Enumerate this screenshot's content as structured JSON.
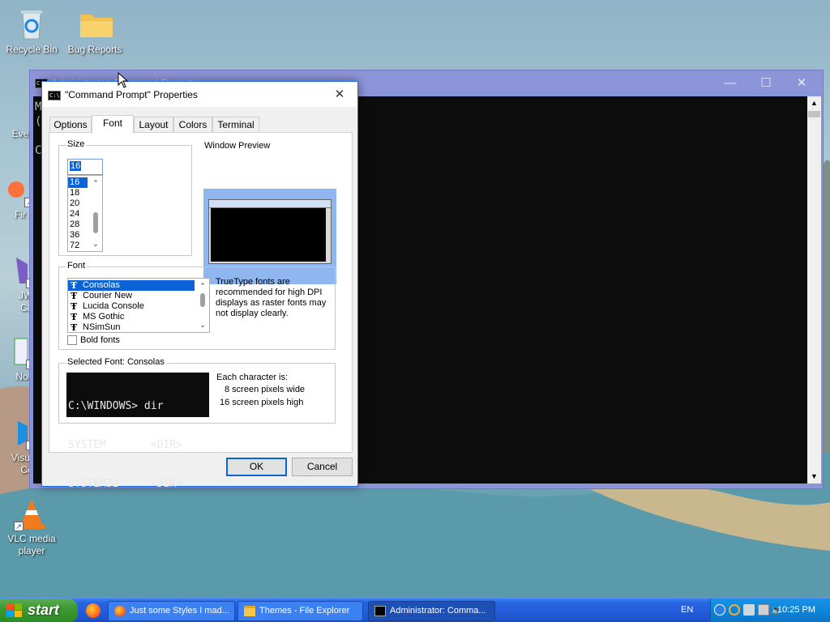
{
  "desktop": {
    "icons": [
      {
        "label": "Recycle Bin",
        "icon": "recycle-bin-icon"
      },
      {
        "label": "Bug Reports",
        "icon": "folder-icon"
      },
      {
        "label": "Eve",
        "icon": "app-icon"
      },
      {
        "label": "Fir",
        "icon": "firefox-icon"
      },
      {
        "label": "JWi",
        "icon": "app-icon"
      },
      {
        "label": "Cle",
        "icon": "app-icon"
      },
      {
        "label": "Note",
        "icon": "notepad-icon"
      },
      {
        "label": "Visual",
        "icon": "vscode-icon"
      },
      {
        "label": "Co",
        "icon": "vscode-icon"
      },
      {
        "label": "VLC media player",
        "icon": "vlc-icon"
      }
    ]
  },
  "console": {
    "title": "Administrator: Command Prompt",
    "lines": [
      "Mi",
      "(c",
      "",
      "C:"
    ]
  },
  "dialog": {
    "title": "\"Command Prompt\" Properties",
    "tabs": [
      "Options",
      "Font",
      "Layout",
      "Colors",
      "Terminal"
    ],
    "active_tab": "Font",
    "size": {
      "legend": "Size",
      "value": "16",
      "options": [
        "16",
        "18",
        "20",
        "24",
        "28",
        "36",
        "72"
      ],
      "selected": "16"
    },
    "window_preview_label": "Window Preview",
    "font": {
      "legend": "Font",
      "options": [
        "Consolas",
        "Courier New",
        "Lucida Console",
        "MS Gothic",
        "NSimSun"
      ],
      "selected": "Consolas",
      "note": "TrueType fonts are recommended for high DPI displays as raster fonts may not display clearly.",
      "bold_label": "Bold fonts",
      "bold_checked": false
    },
    "selected_font": {
      "legend": "Selected Font: Consolas",
      "sample_lines": [
        "C:\\WINDOWS> dir",
        "SYSTEM       <DIR>",
        "SYSTEM32     <DIR>"
      ],
      "char_heading": "Each character is:",
      "width_text": "8 screen pixels wide",
      "height_text": "16 screen pixels high"
    },
    "ok_label": "OK",
    "cancel_label": "Cancel"
  },
  "taskbar": {
    "start_label": "start",
    "tasks": [
      {
        "label": "Just some Styles I mad...",
        "icon": "firefox-icon"
      },
      {
        "label": "Themes - File Explorer",
        "icon": "folder-icon"
      },
      {
        "label": "Administrator: Comma...",
        "icon": "cmd-icon"
      }
    ],
    "language": "EN",
    "clock": "10:25 PM"
  },
  "colors": {
    "accent": "#0a64d8",
    "taskbar": "#245edb",
    "start": "#3c9a33",
    "console_bg": "#0c0c0c"
  }
}
